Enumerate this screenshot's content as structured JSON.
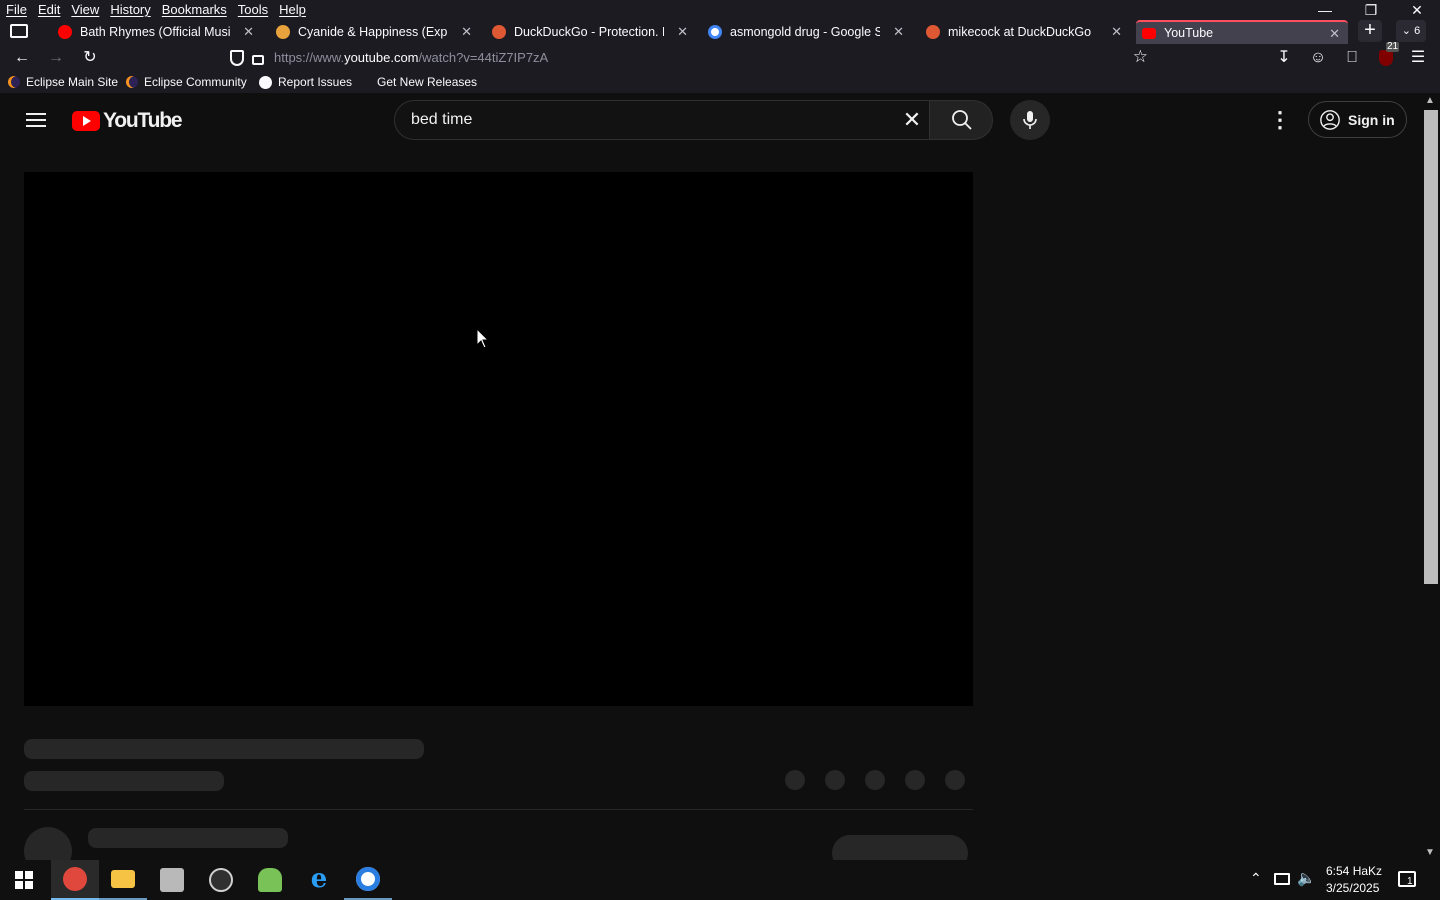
{
  "menubar": {
    "items": [
      "File",
      "Edit",
      "View",
      "History",
      "Bookmarks",
      "Tools",
      "Help"
    ]
  },
  "tabs": [
    {
      "title": "Bath Rhymes (Official Music V",
      "icon": "youtube-icon",
      "color": "#ff0000"
    },
    {
      "title": "Cyanide & Happiness (Explosm",
      "icon": "explosm-icon",
      "color": "#e8a33c"
    },
    {
      "title": "DuckDuckGo - Protection. Priv",
      "icon": "duckduckgo-icon",
      "color": "#de5833"
    },
    {
      "title": "asmongold drug - Google Sea",
      "icon": "google-icon",
      "color": "#ffffff"
    },
    {
      "title": "mikecock at DuckDuckGo",
      "icon": "duckduckgo-icon",
      "color": "#de5833"
    },
    {
      "title": "YouTube",
      "icon": "youtube-icon",
      "color": "#ff0000",
      "active": true
    }
  ],
  "tab_count": "6",
  "address": {
    "prefix": "https://www.",
    "domain": "youtube.com",
    "path": "/watch?v=44tiZ7IP7zA"
  },
  "extension_badge": "21",
  "bookmarks": [
    "Eclipse Main Site",
    "Eclipse Community",
    "Report Issues",
    "Get New Releases"
  ],
  "youtube": {
    "logo_text": "YouTube",
    "search_value": "bed time",
    "signin_label": "Sign in"
  },
  "taskbar": {
    "time": "6:54 HaKz",
    "date": "3/25/2025",
    "notification_count": "1"
  }
}
